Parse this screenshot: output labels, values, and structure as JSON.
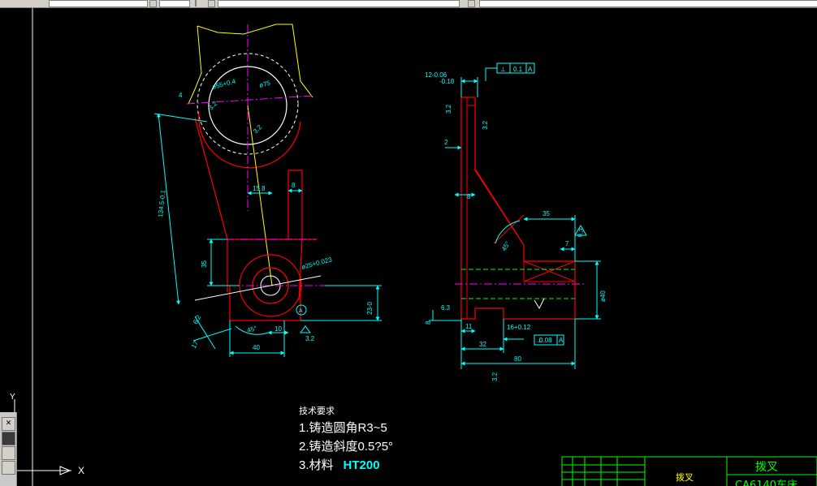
{
  "colors": {
    "background": "#000000",
    "outline": "#ff0000",
    "dimension": "#00ffff",
    "centerline": "#ff00ff",
    "hidden": "#00ff00",
    "border": "#ffffff",
    "title_block": "#00ff00",
    "yellow": "#ffff00"
  },
  "dims_left": {
    "d55": "ø55+0.4",
    "d75": "ø75",
    "d4": "4",
    "r32a": "3.2",
    "r32b": "3.2",
    "len": "134.5-0.1",
    "w158": "15.8",
    "w8": "8",
    "h35": "35",
    "d25": "ø25+0.023",
    "h23": "23-0",
    "a45": "45°",
    "w10": "10",
    "r32c": "3.2",
    "w40": "40",
    "w62": "6.2",
    "w17": "17",
    "ref_a": "A"
  },
  "dims_right": {
    "tol_top": "12-0.06",
    "tol_bot": "-0.18",
    "perp": "⊥",
    "perp_val": "0.1",
    "perp_ref": "A",
    "r32a": "3.2",
    "r32b": "3.2",
    "w2": "2",
    "w8": "8",
    "w35": "35",
    "r63": "6.3",
    "a45": "45°",
    "w7": "7",
    "d40": "ø40",
    "r63b": "6.3",
    "h8": "8",
    "w11": "11",
    "w16": "16+0.12",
    "w32": "32",
    "perp2_val": "0.08",
    "perp2_ref": "A",
    "w80": "80",
    "r32c": "3.2"
  },
  "tech_requirements": {
    "title": "技术要求",
    "line1": "1.铸造圆角R3~5",
    "line2": "2.铸造斜度0.5?5°",
    "line3_prefix": "3.材料",
    "material": "HT200"
  },
  "title_block": {
    "part_name": "拨叉",
    "name_large": "拨叉",
    "machine": "CA6140车床"
  },
  "ucs": {
    "x_label": "X",
    "y_label": "Y"
  }
}
